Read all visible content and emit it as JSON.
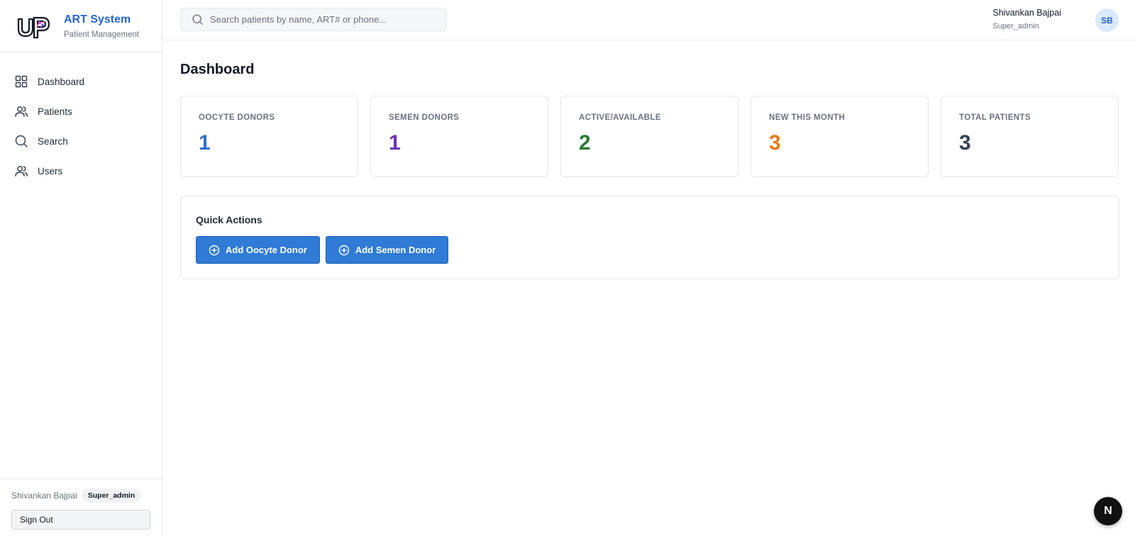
{
  "brand": {
    "logo_text": "UP",
    "title": "ART System",
    "subtitle": "Patient Management"
  },
  "sidebar": {
    "items": [
      {
        "label": "Dashboard",
        "icon": "grid-icon"
      },
      {
        "label": "Patients",
        "icon": "users-icon"
      },
      {
        "label": "Search",
        "icon": "search-icon"
      },
      {
        "label": "Users",
        "icon": "users-icon"
      }
    ],
    "footer": {
      "user_name": "Shivankan Bajpai",
      "role": "Super_admin",
      "sign_out_label": "Sign Out"
    }
  },
  "topbar": {
    "search_placeholder": "Search patients by name, ART# or phone...",
    "user_name": "Shivankan Bajpai",
    "user_role": "Super_admin",
    "avatar_initials": "SB"
  },
  "main": {
    "title": "Dashboard",
    "stats": [
      {
        "label": "OOCYTE DONORS",
        "value": "1",
        "color": "#2f6fd0"
      },
      {
        "label": "SEMEN DONORS",
        "value": "1",
        "color": "#6b33b8"
      },
      {
        "label": "ACTIVE/AVAILABLE",
        "value": "2",
        "color": "#2a7a34"
      },
      {
        "label": "NEW THIS MONTH",
        "value": "3",
        "color": "#ea7a14"
      },
      {
        "label": "TOTAL PATIENTS",
        "value": "3",
        "color": "#374151"
      }
    ],
    "quick_actions": {
      "title": "Quick Actions",
      "buttons": [
        {
          "label": "Add Oocyte Donor",
          "icon": "plus-circle-icon"
        },
        {
          "label": "Add Semen Donor",
          "icon": "plus-circle-icon"
        }
      ]
    }
  },
  "fab": {
    "label": "N"
  },
  "colors": {
    "accent": "#2f7bd6",
    "brand_title": "#2563c9"
  }
}
